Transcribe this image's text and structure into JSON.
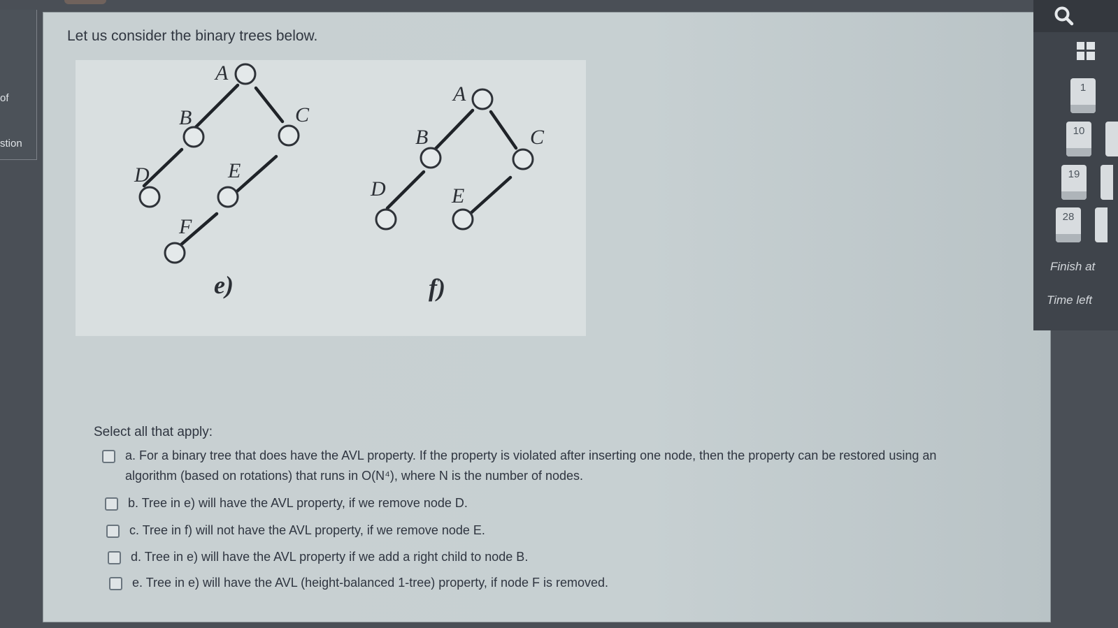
{
  "left_nav": {
    "item1": "of",
    "item2": "stion"
  },
  "question": {
    "intro": "Let us consider the binary trees below.",
    "tree_e": {
      "caption": "e)",
      "labels": [
        "A",
        "B",
        "C",
        "D",
        "E",
        "F"
      ]
    },
    "tree_f": {
      "caption": "f)",
      "labels": [
        "A",
        "B",
        "C",
        "D",
        "E"
      ]
    },
    "select_label": "Select all that apply:",
    "options": [
      {
        "label": "a. For a binary tree that does have the AVL property. If the property is violated after inserting one node, then the property can be restored using an algorithm (based on rotations) that runs in O(N⁴), where N is the number of nodes.",
        "checked": false
      },
      {
        "label": "b. Tree in e) will have the AVL property, if we remove node D.",
        "checked": false
      },
      {
        "label": "c. Tree in f) will  not have the AVL property, if we remove node E.",
        "checked": false
      },
      {
        "label": "d. Tree in e) will have the AVL property if we add a right child to node B.",
        "checked": false
      },
      {
        "label": "e. Tree in e) will have the AVL (height-balanced 1-tree) property, if node F is removed.",
        "checked": false
      }
    ]
  },
  "quiz_nav": {
    "buttons": [
      "1",
      "10",
      "19",
      "28"
    ],
    "finish_label": "Finish at",
    "time_left_label": "Time left"
  },
  "icons": {
    "search": "search-icon",
    "grid": "grid-icon"
  }
}
